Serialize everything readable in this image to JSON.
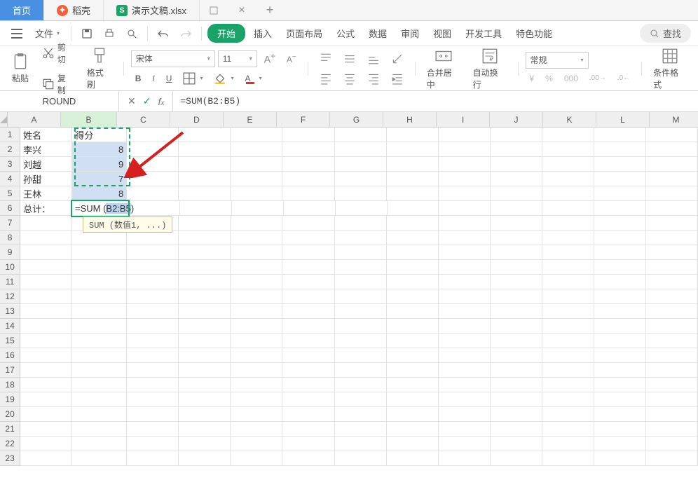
{
  "tabs": {
    "home": "首页",
    "t2": "稻壳",
    "t3": "演示文稿.xlsx",
    "close": "×",
    "new": "+"
  },
  "menu": {
    "file": "文件",
    "start": "开始",
    "insert": "插入",
    "layout": "页面布局",
    "formula": "公式",
    "data": "数据",
    "review": "审阅",
    "view": "视图",
    "dev": "开发工具",
    "special": "特色功能",
    "search": "查找"
  },
  "ribbon": {
    "cut": "剪切",
    "copy": "复制",
    "paste": "粘贴",
    "brush": "格式刷",
    "font_name": "宋体",
    "font_size": "11",
    "merge": "合并居中",
    "wrap": "自动换行",
    "numfmt": "常规",
    "condfmt": "条件格式"
  },
  "fx": {
    "name": "ROUND",
    "formula": "=SUM(B2:B5)"
  },
  "cols": [
    "A",
    "B",
    "C",
    "D",
    "E",
    "F",
    "G",
    "H",
    "I",
    "J",
    "K",
    "L",
    "M"
  ],
  "rowcount": 23,
  "data": {
    "A1": "姓名",
    "B1": "得分",
    "A2": "李兴",
    "B2": "8",
    "A3": "刘越",
    "B3": "9",
    "A4": "孙甜",
    "B4": "7",
    "A5": "王林",
    "B5": "8",
    "A6": "总计：",
    "B6_pre": "=SUM (",
    "B6_hl": "B2:B5",
    "B6_post": ")"
  },
  "tooltip": "SUM (数值1, ...)"
}
